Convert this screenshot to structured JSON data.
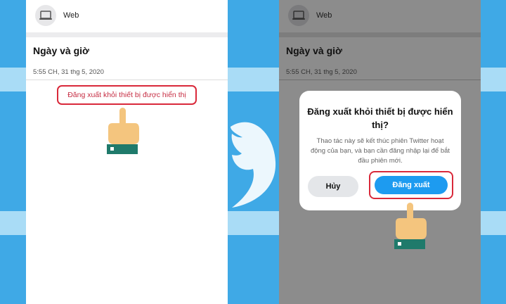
{
  "left_screen": {
    "device_label": "Web",
    "section_title": "Ngày và giờ",
    "timestamp": "5:55 CH, 31 thg 5, 2020",
    "logout_link": "Đăng xuất khỏi thiết bị được hiển thị"
  },
  "right_screen": {
    "device_label": "Web",
    "section_title": "Ngày và giờ",
    "timestamp": "5:55 CH, 31 thg 5, 2020",
    "dialog": {
      "title": "Đăng xuất khỏi thiết bị được hiển thị?",
      "message": "Thao tác này sẽ kết thúc phiên Twitter hoạt động của bạn, và bạn cần đăng nhập lại để bắt đầu phiên mới.",
      "cancel_label": "Hủy",
      "confirm_label": "Đăng xuất"
    }
  },
  "colors": {
    "background": "#3fa9e6",
    "accent": "#1d9bf0",
    "highlight": "#d9293a",
    "link": "#c62d43",
    "overlay": "#8c8c8c"
  },
  "icons": [
    "laptop-icon",
    "pointing-hand-icon",
    "twitter-bird-icon"
  ]
}
